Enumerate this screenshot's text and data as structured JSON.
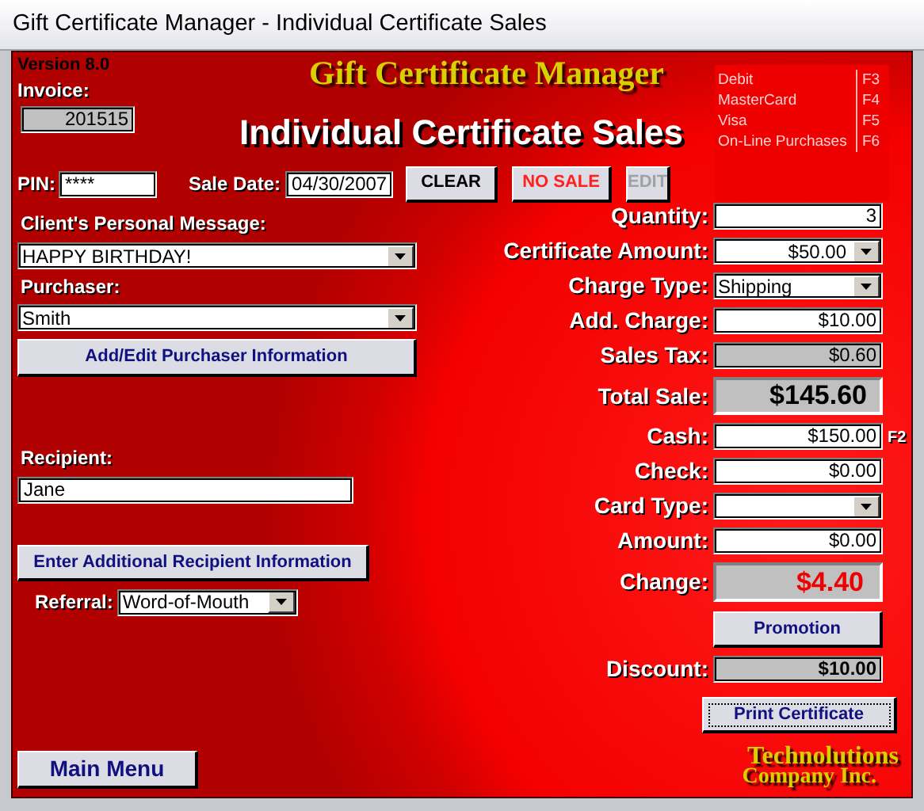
{
  "window": {
    "title": "Gift Certificate Manager - Individual Certificate Sales"
  },
  "version": "Version 8.0",
  "invoice": {
    "label": "Invoice:",
    "value": "201515"
  },
  "logo": "Gift Certificate Manager",
  "heading": "Individual Certificate Sales",
  "pin": {
    "label": "PIN:",
    "value": "****"
  },
  "sale_date": {
    "label": "Sale Date:",
    "value": "04/30/2007"
  },
  "actions": [
    {
      "label": "CLEAR",
      "kind": "normal",
      "disabled": false
    },
    {
      "label": "NO SALE",
      "kind": "alert",
      "disabled": false
    },
    {
      "label": "EDIT",
      "kind": "normal",
      "disabled": true
    }
  ],
  "shortcuts": [
    {
      "label": "Debit",
      "key": "F3"
    },
    {
      "label": "MasterCard",
      "key": "F4"
    },
    {
      "label": "Visa",
      "key": "F5"
    },
    {
      "label": "On-Line Purchases",
      "key": "F6"
    }
  ],
  "message": {
    "label": "Client's Personal Message:",
    "value": "HAPPY BIRTHDAY!"
  },
  "purchaser": {
    "label": "Purchaser:",
    "value": "Smith",
    "button": "Add/Edit Purchaser Information"
  },
  "recipient": {
    "label": "Recipient:",
    "value": "Jane",
    "button": "Enter Additional Recipient Information"
  },
  "referral": {
    "label": "Referral:",
    "value": "Word-of-Mouth"
  },
  "main_menu": "Main Menu",
  "sale_fields": [
    {
      "label": "Quantity:",
      "value": "3",
      "kind": "input"
    },
    {
      "label": "Certificate Amount:",
      "value": "$50.00",
      "kind": "money_select"
    },
    {
      "label": "Charge Type:",
      "value": "Shipping",
      "kind": "select"
    },
    {
      "label": "Add. Charge:",
      "value": "$10.00",
      "kind": "input"
    },
    {
      "label": "Sales Tax:",
      "value": "$0.60",
      "kind": "display"
    },
    {
      "label": "Total Sale:",
      "value": "$145.60",
      "kind": "total"
    },
    {
      "label": "Cash:",
      "value": "$150.00",
      "kind": "input",
      "shortcut": "F2"
    },
    {
      "label": "Check:",
      "value": "$0.00",
      "kind": "input"
    },
    {
      "label": "Card Type:",
      "kind": "select"
    },
    {
      "label": "Amount:",
      "value": "$0.00",
      "kind": "input"
    },
    {
      "label": "Change:",
      "value": "$4.40",
      "kind": "change"
    },
    {
      "label": "Promotion",
      "kind": "button",
      "focused": false
    },
    {
      "label": "Discount:",
      "value": "$10.00",
      "kind": "discount"
    },
    {
      "label": "Print Certificate",
      "kind": "button",
      "focused": true
    }
  ],
  "company": [
    "Technolutions",
    "Company Inc."
  ]
}
